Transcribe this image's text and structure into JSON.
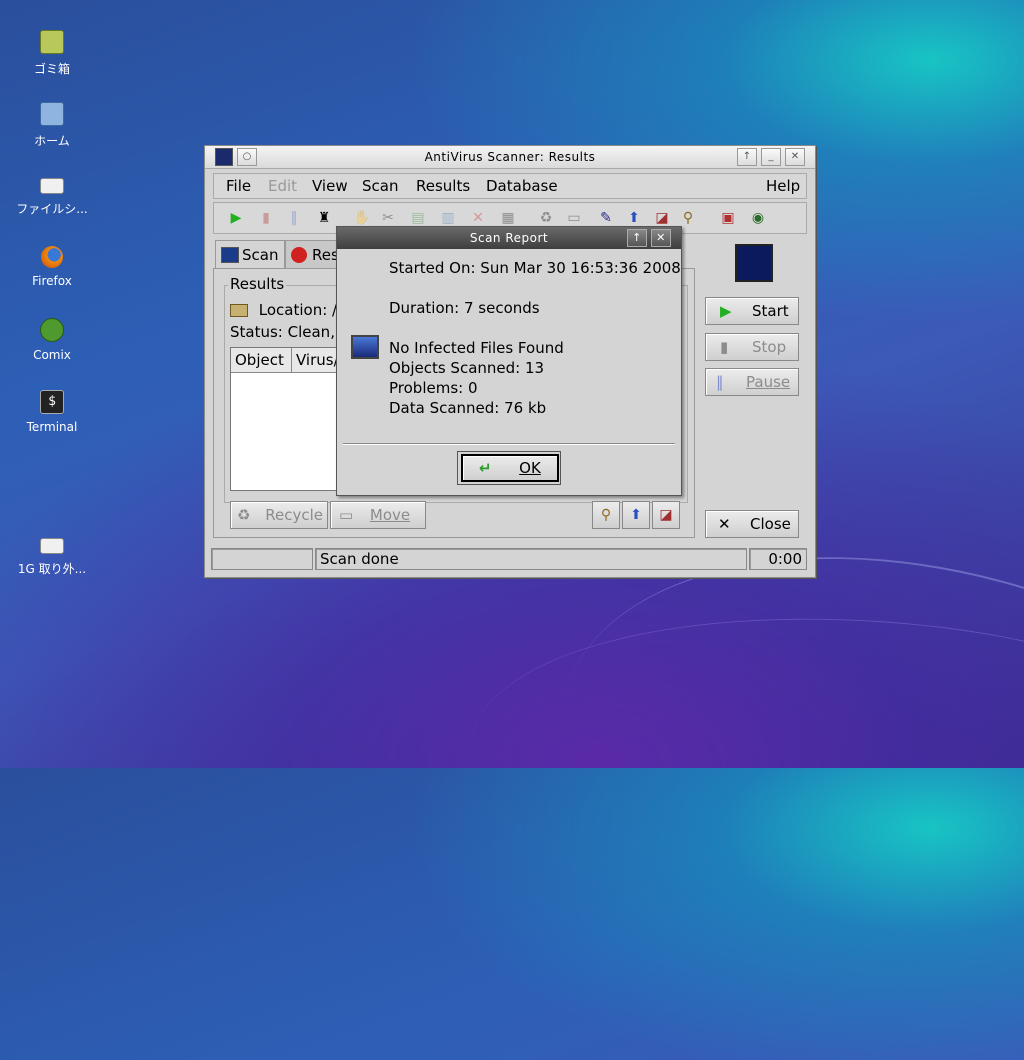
{
  "desktop": {
    "icons": [
      {
        "label": "ゴミ箱",
        "icon": "trash-icon"
      },
      {
        "label": "ホーム",
        "icon": "home-folder-icon"
      },
      {
        "label": "ファイルシ...",
        "icon": "filesystem-icon"
      },
      {
        "label": "Firefox",
        "icon": "firefox-icon"
      },
      {
        "label": "Comix",
        "icon": "comix-icon"
      },
      {
        "label": "Terminal",
        "icon": "terminal-icon"
      },
      {
        "label": "1G 取り外...",
        "icon": "removable-drive-icon"
      }
    ]
  },
  "window": {
    "title": "AntiVirus Scanner: Results",
    "menu": {
      "file": "File",
      "edit": "Edit",
      "view": "View",
      "scan": "Scan",
      "results": "Results",
      "database": "Database",
      "help": "Help"
    },
    "tabs": {
      "scan": "Scan",
      "results": "Res"
    },
    "results_group": {
      "title": "Results",
      "location": "Location: /h",
      "status": "Status: Clean,",
      "columns": {
        "object": "Object",
        "virus": "Virus/"
      }
    },
    "buttons": {
      "recycle": "Recycle",
      "move": "Move",
      "start": "Start",
      "stop": "Stop",
      "pause": "Pause",
      "close": "Close"
    },
    "statusbar": {
      "message": "Scan done",
      "time": "0:00"
    }
  },
  "dialog": {
    "title": "Scan Report",
    "started_on": "Started On: Sun Mar 30 16:53:36 2008",
    "duration": "Duration: 7 seconds",
    "result": "No Infected Files Found",
    "objects_scanned": "Objects Scanned: 13",
    "problems": "Problems: 0",
    "data_scanned": "Data Scanned: 76 kb",
    "ok": "OK"
  },
  "colors": {
    "accent_navy": "#0a1a5c",
    "start_green": "#22b022"
  }
}
